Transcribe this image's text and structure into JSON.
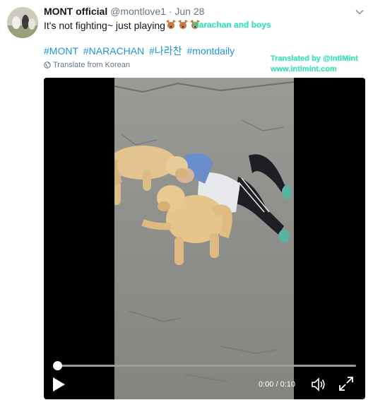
{
  "tweet": {
    "author_name": "MONT official",
    "handle": "@montlove1",
    "separator": "·",
    "date": "Jun 28",
    "text": "It's not fighting~ just playing",
    "emojis": [
      "dog-face-emoji",
      "dog-face-emoji",
      "dog-face-emoji"
    ],
    "hashtags": [
      "#MONT",
      "#NARACHAN",
      "#나라찬",
      "#montdaily"
    ],
    "translate_label": "Translate from Korean"
  },
  "overlay": {
    "caption": "Narachan and boys",
    "credit_line1": "Translated by @IntlMint",
    "credit_line2": "www.intlmint.com",
    "color": "#2ee6b8"
  },
  "video": {
    "time_display": "0:00 / 0:10",
    "progress": 0
  },
  "colors": {
    "link": "#1b95e0",
    "muted": "#657786",
    "text": "#14171a"
  }
}
